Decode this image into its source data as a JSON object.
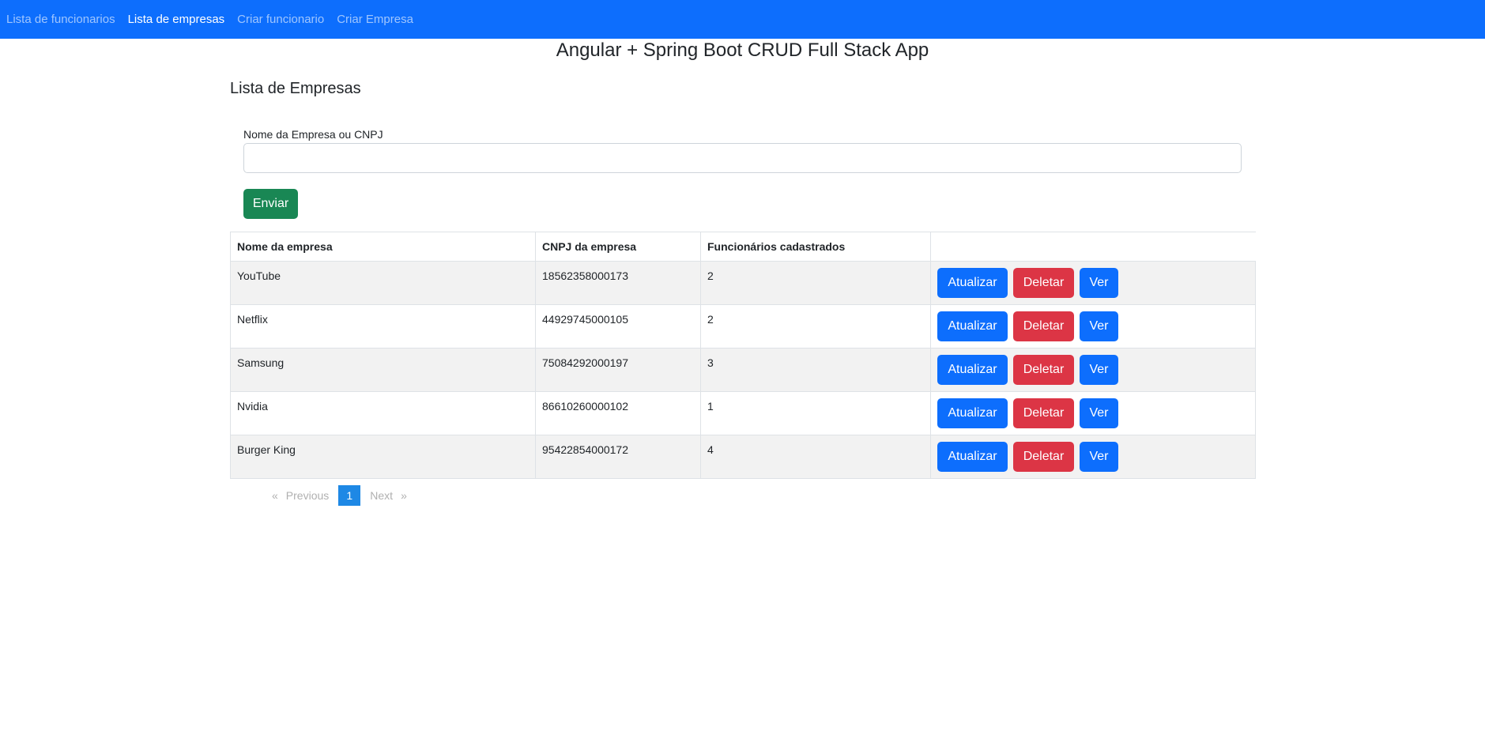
{
  "nav": {
    "items": [
      {
        "label": "Lista de funcionarios"
      },
      {
        "label": "Lista de empresas"
      },
      {
        "label": "Criar funcionario"
      },
      {
        "label": "Criar Empresa"
      }
    ]
  },
  "app_title": "Angular + Spring Boot CRUD Full Stack App",
  "page_title": "Lista de Empresas",
  "search": {
    "label": "Nome da Empresa ou CNPJ",
    "value": "",
    "submit_label": "Enviar"
  },
  "table": {
    "headers": [
      "Nome da empresa",
      "CNPJ da empresa",
      "Funcionários cadastrados",
      ""
    ],
    "rows": [
      {
        "name": "YouTube",
        "cnpj": "18562358000173",
        "count": "2"
      },
      {
        "name": "Netflix",
        "cnpj": "44929745000105",
        "count": "2"
      },
      {
        "name": "Samsung",
        "cnpj": "75084292000197",
        "count": "3"
      },
      {
        "name": "Nvidia",
        "cnpj": "86610260000102",
        "count": "1"
      },
      {
        "name": "Burger King",
        "cnpj": "95422854000172",
        "count": "4"
      }
    ],
    "actions": {
      "update_label": "Atualizar",
      "delete_label": "Deletar",
      "view_label": "Ver"
    }
  },
  "pagination": {
    "prev_arrow": "«",
    "prev_label": "Previous",
    "current_page": "1",
    "next_label": "Next",
    "next_arrow": "»"
  },
  "colors": {
    "primary": "#0d6efd",
    "success": "#198754",
    "danger": "#dc3545",
    "page_active": "#1e88e5"
  }
}
